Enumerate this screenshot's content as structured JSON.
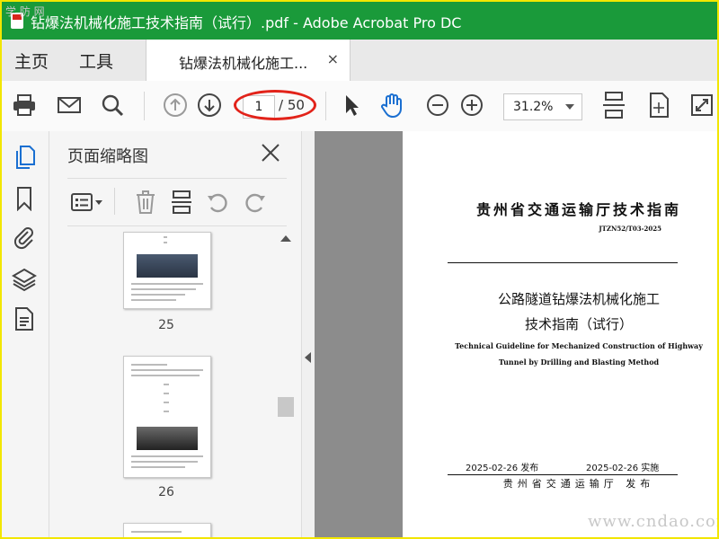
{
  "window": {
    "title": "钻爆法机械化施工技术指南（试行）.pdf - Adobe Acrobat Pro DC",
    "corner_mark": "学 防 网"
  },
  "tabs": {
    "home": "主页",
    "tools": "工具",
    "document": "钻爆法机械化施工...",
    "close": "×"
  },
  "toolbar": {
    "current_page": "1",
    "page_total": "/ 50",
    "zoom": "31.2%"
  },
  "sidebar_icons": [
    "pages-icon",
    "bookmark-icon",
    "attachment-icon",
    "layers-icon",
    "document-properties-icon"
  ],
  "thumbnail_panel": {
    "title": "页面缩略图",
    "thumbnails": [
      {
        "page": "25"
      },
      {
        "page": "26"
      }
    ]
  },
  "document_page": {
    "org_header": "贵州省交通运输厅技术指南",
    "code": "JTZN52/T03-2025",
    "title_line1": "公路隧道钻爆法机械化施工",
    "title_line2": "技术指南（试行）",
    "english_line1": "Technical Guideline for Mechanized Construction of Highway",
    "english_line2": "Tunnel by Drilling and Blasting Method",
    "publish_date": "2025-02-26 发布",
    "effective_date": "2025-02-26 实施",
    "issuer": "贵州省交通运输厅 发布"
  },
  "watermark": "www.cndao.com",
  "colors": {
    "title_bar": "#1a9a3a",
    "annotation_oval": "#e2231a",
    "hand_tool": "#1a6fd1",
    "sidebar_active": "#1a6fd1"
  }
}
